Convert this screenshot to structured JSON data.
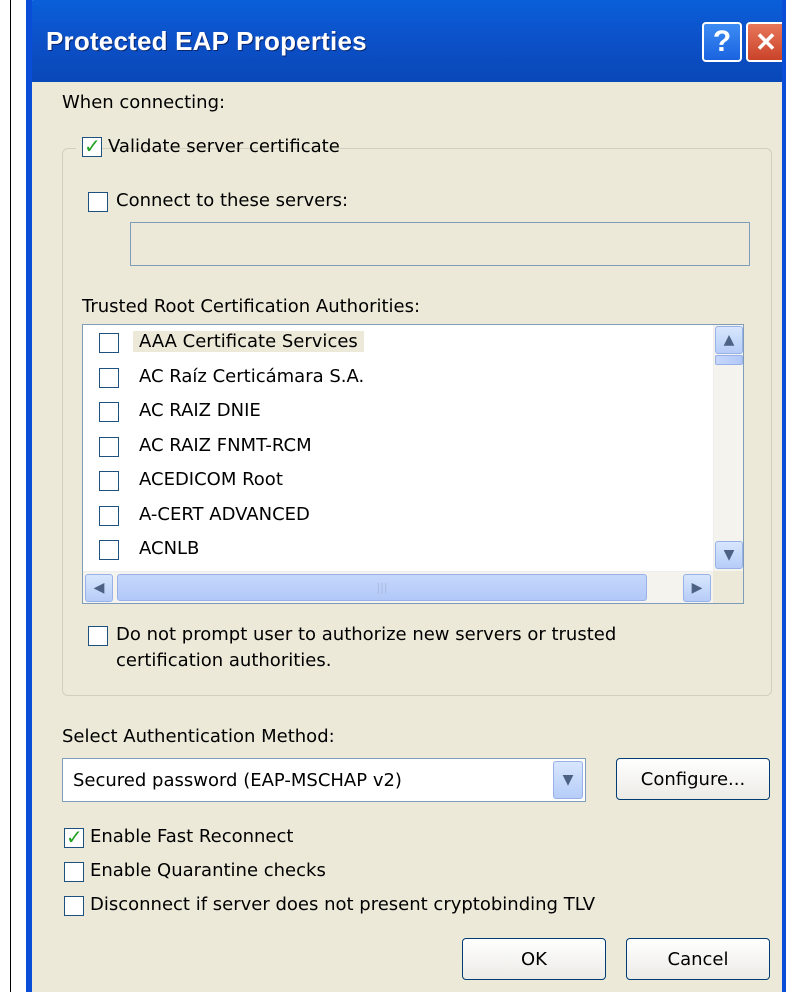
{
  "window": {
    "title": "Protected EAP Properties"
  },
  "titlebar": {
    "help_glyph": "?",
    "close_glyph": "✕"
  },
  "connecting": {
    "heading": "When connecting:",
    "validate_label": "Validate server certificate",
    "validate_checked": true,
    "connect_label": "Connect to these servers:",
    "connect_checked": false,
    "servers_value": "",
    "trusted_label": "Trusted Root Certification Authorities:",
    "authorities": [
      {
        "name": "AAA Certificate Services",
        "checked": false
      },
      {
        "name": "AC Raíz Certicámara S.A.",
        "checked": false
      },
      {
        "name": "AC RAIZ DNIE",
        "checked": false
      },
      {
        "name": "AC RAIZ FNMT-RCM",
        "checked": false
      },
      {
        "name": "ACEDICOM Root",
        "checked": false
      },
      {
        "name": "A-CERT ADVANCED",
        "checked": false
      },
      {
        "name": "ACNLB",
        "checked": false
      }
    ],
    "prompt_label_line1": "Do not prompt user to authorize new servers or trusted",
    "prompt_label_line2": "certification authorities.",
    "prompt_checked": false
  },
  "auth": {
    "heading": "Select Authentication Method:",
    "method_value": "Secured password (EAP-MSCHAP v2)",
    "configure_label": "Configure..."
  },
  "options": {
    "fast_reconnect_label": "Enable Fast Reconnect",
    "fast_reconnect_checked": true,
    "quarantine_label": "Enable Quarantine checks",
    "quarantine_checked": false,
    "cryptobinding_label": "Disconnect if server does not present cryptobinding TLV",
    "cryptobinding_checked": false
  },
  "footer": {
    "ok_label": "OK",
    "cancel_label": "Cancel"
  },
  "colors": {
    "title_blue": "#0c4fc6",
    "face": "#ece9d8",
    "check_green": "#21a121",
    "close_red": "#c9432a"
  }
}
